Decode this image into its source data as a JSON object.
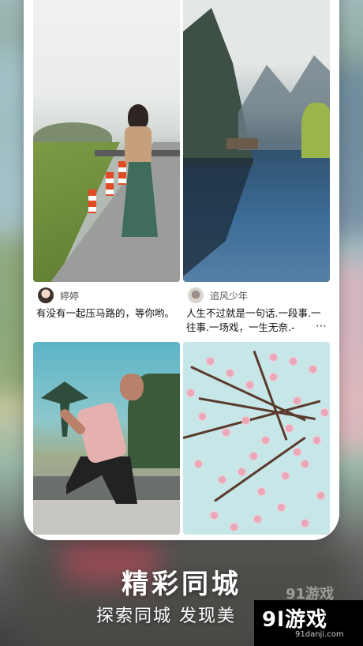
{
  "feed": {
    "cards": [
      {
        "username": "婷婷",
        "caption": "有没有一起压马路的，等你哟。",
        "image_icon": "photo-girl-on-road"
      },
      {
        "username": "追风少年",
        "caption_line1": "人生不过就是一句话.一段事.一",
        "caption_line2": "往事.一场戏，一生无奈.-",
        "more_icon": "⋯",
        "image_icon": "photo-mountain-lake"
      },
      {
        "image_icon": "photo-skateboarder"
      },
      {
        "image_icon": "photo-cherry-blossom"
      }
    ]
  },
  "promo": {
    "headline": "精彩同城",
    "subline": "探索同城 发现美"
  },
  "watermark": {
    "top_text": "91游戏",
    "logo": "9l游戏",
    "url": "91danji.com"
  }
}
